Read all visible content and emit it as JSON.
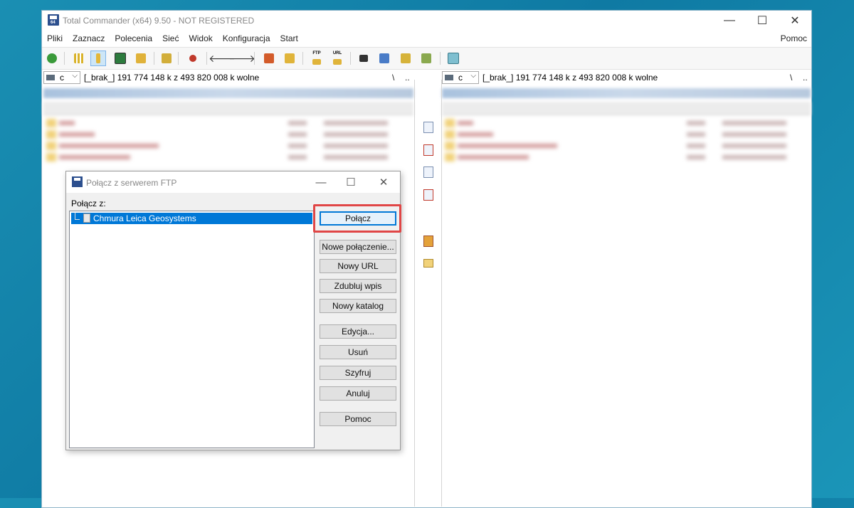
{
  "window": {
    "title": "Total Commander (x64) 9.50 - NOT REGISTERED",
    "app_icon_text": "64"
  },
  "menu": {
    "items": [
      "Pliki",
      "Zaznacz",
      "Polecenia",
      "Sieć",
      "Widok",
      "Konfiguracja",
      "Start"
    ],
    "help": "Pomoc"
  },
  "toolbar": {
    "icons": [
      "refresh-icon",
      "brief-view-icon",
      "detailed-view-icon",
      "thumbnails-icon",
      "tree-view-icon",
      "invert-selection-icon",
      "unpack-icon",
      "back-icon",
      "forward-icon",
      "pack-icon",
      "unpack-all-icon",
      "ftp-connect-icon",
      "url-connect-icon",
      "search-icon",
      "compare-dirs-icon",
      "sync-dirs-icon",
      "multi-rename-icon",
      "notepad-icon"
    ],
    "ftp_label": "FTP",
    "url_label": "URL"
  },
  "left_panel": {
    "drive": "c",
    "drive_info": "[_brak_]  191 774 148 k z 493 820 008 k wolne",
    "root_btn": "\\",
    "up_btn": ".."
  },
  "right_panel": {
    "drive": "c",
    "drive_info": "[_brak_]  191 774 148 k z 493 820 008 k wolne",
    "root_btn": "\\",
    "up_btn": ".."
  },
  "dialog": {
    "title": "Połącz z serwerem FTP",
    "label": "Połącz z:",
    "tree_items": [
      "Chmura Leica Geosystems"
    ],
    "buttons": {
      "connect": "Połącz",
      "new_connection": "Nowe połączenie...",
      "new_url": "Nowy URL",
      "duplicate": "Zdubluj wpis",
      "new_folder": "Nowy katalog",
      "edit": "Edycja...",
      "delete": "Usuń",
      "encrypt": "Szyfruj",
      "cancel": "Anuluj",
      "help": "Pomoc"
    }
  },
  "colors": {
    "selection": "#0078d7",
    "highlight_box": "#e04646",
    "desktop": "#1a8fb3"
  }
}
